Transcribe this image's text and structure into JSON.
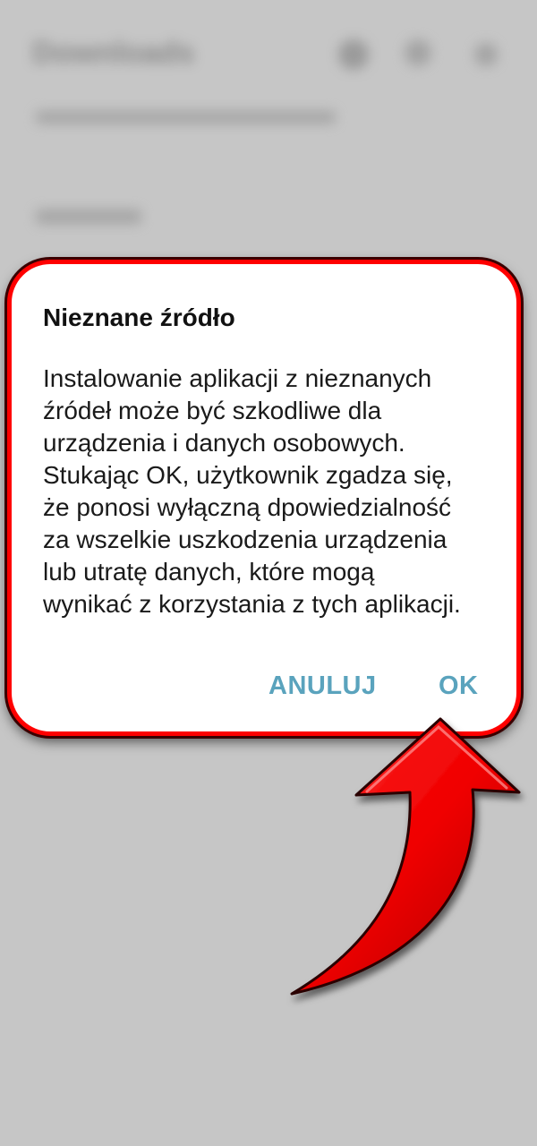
{
  "background": {
    "title": "Downloads"
  },
  "dialog": {
    "title": "Nieznane źródło",
    "body_lines": [
      "Instalowanie aplikacji z nieznanych",
      "źródeł może być szkodliwe dla",
      "urządzenia i danych osobowych.",
      "Stukając OK, użytkownik zgadza się,",
      "że ponosi wyłączną dpowiedzialność",
      "za wszelkie uszkodzenia urządzenia",
      "lub utratę danych, które mogą",
      "wynikać z korzystania z tych aplikacji."
    ],
    "cancel_label": "ANULUJ",
    "ok_label": "OK"
  },
  "colors": {
    "highlight": "#ff0000",
    "button_text": "#5aa3bd",
    "dim_background": "#c6c6c6"
  }
}
